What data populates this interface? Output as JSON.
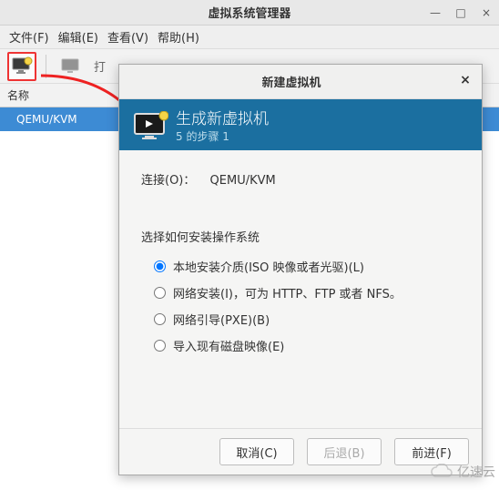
{
  "main": {
    "title": "虚拟系统管理器",
    "win_min": "—",
    "win_max": "□",
    "win_close": "×"
  },
  "menubar": {
    "file": "文件(F)",
    "edit": "编辑(E)",
    "view": "查看(V)",
    "help": "帮助(H)"
  },
  "toolbar": {
    "open_label": "打"
  },
  "list": {
    "name_col": "名称",
    "row0": "QEMU/KVM"
  },
  "dialog": {
    "title": "新建虚拟机",
    "close": "×",
    "header_title": "生成新虚拟机",
    "header_step": "5 的步骤 1",
    "conn_label": "连接(O)：",
    "conn_value": "QEMU/KVM",
    "section": "选择如何安装操作系统",
    "radios": {
      "local": "本地安装介质(ISO 映像或者光驱)(L)",
      "net": "网络安装(I)，可为 HTTP、FTP 或者 NFS。",
      "pxe": "网络引导(PXE)(B)",
      "import": "导入现有磁盘映像(E)"
    },
    "btn_cancel": "取消(C)",
    "btn_back": "后退(B)",
    "btn_forward": "前进(F)"
  },
  "watermark": "亿速云"
}
